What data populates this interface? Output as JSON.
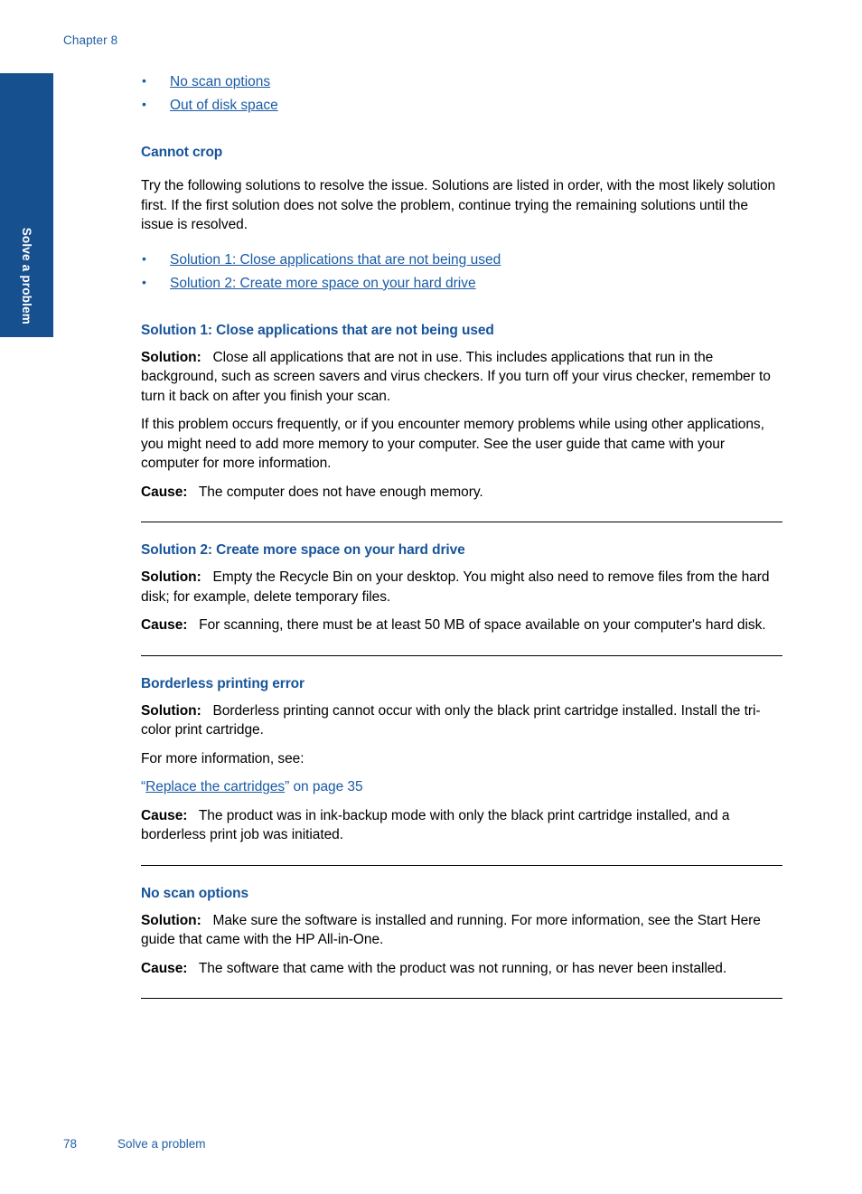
{
  "page": {
    "chapter_header": "Chapter 8",
    "side_tab_label": "Solve a problem",
    "footer_page_number": "78",
    "footer_section": "Solve a problem",
    "accent_blue": "#17549b",
    "link_blue": "#1a5ba6",
    "tab_blue": "#17508f"
  },
  "top_links": [
    {
      "label": "No scan options"
    },
    {
      "label": "Out of disk space"
    }
  ],
  "sections": {
    "cannot_crop": {
      "heading": "Cannot crop",
      "intro": "Try the following solutions to resolve the issue. Solutions are listed in order, with the most likely solution first. If the first solution does not solve the problem, continue trying the remaining solutions until the issue is resolved.",
      "links": [
        {
          "label": "Solution 1: Close applications that are not being used"
        },
        {
          "label": "Solution 2: Create more space on your hard drive"
        }
      ]
    },
    "solution1": {
      "heading": "Solution 1: Close applications that are not being used",
      "solution_label": "Solution:",
      "solution_text": "Close all applications that are not in use. This includes applications that run in the background, such as screen savers and virus checkers. If you turn off your virus checker, remember to turn it back on after you finish your scan.",
      "solution_text2": "If this problem occurs frequently, or if you encounter memory problems while using other applications, you might need to add more memory to your computer. See the user guide that came with your computer for more information.",
      "cause_label": "Cause:",
      "cause_text": "The computer does not have enough memory."
    },
    "solution2": {
      "heading": "Solution 2: Create more space on your hard drive",
      "solution_label": "Solution:",
      "solution_text": "Empty the Recycle Bin on your desktop. You might also need to remove files from the hard disk; for example, delete temporary files.",
      "cause_label": "Cause:",
      "cause_text": "For scanning, there must be at least 50 MB of space available on your computer's hard disk."
    },
    "borderless": {
      "heading": "Borderless printing error",
      "solution_label": "Solution:",
      "solution_text": "Borderless printing cannot occur with only the black print cartridge installed. Install the tri-color print cartridge.",
      "more_info": "For more information, see:",
      "xref_open_quote": "“",
      "xref_link": "Replace the cartridges",
      "xref_tail": "” on page 35",
      "cause_label": "Cause:",
      "cause_text": "The product was in ink-backup mode with only the black print cartridge installed, and a borderless print job was initiated."
    },
    "no_scan_options": {
      "heading": "No scan options",
      "solution_label": "Solution:",
      "solution_text": "Make sure the software is installed and running. For more information, see the Start Here guide that came with the HP All-in-One.",
      "cause_label": "Cause:",
      "cause_text": "The software that came with the product was not running, or has never been installed."
    }
  }
}
